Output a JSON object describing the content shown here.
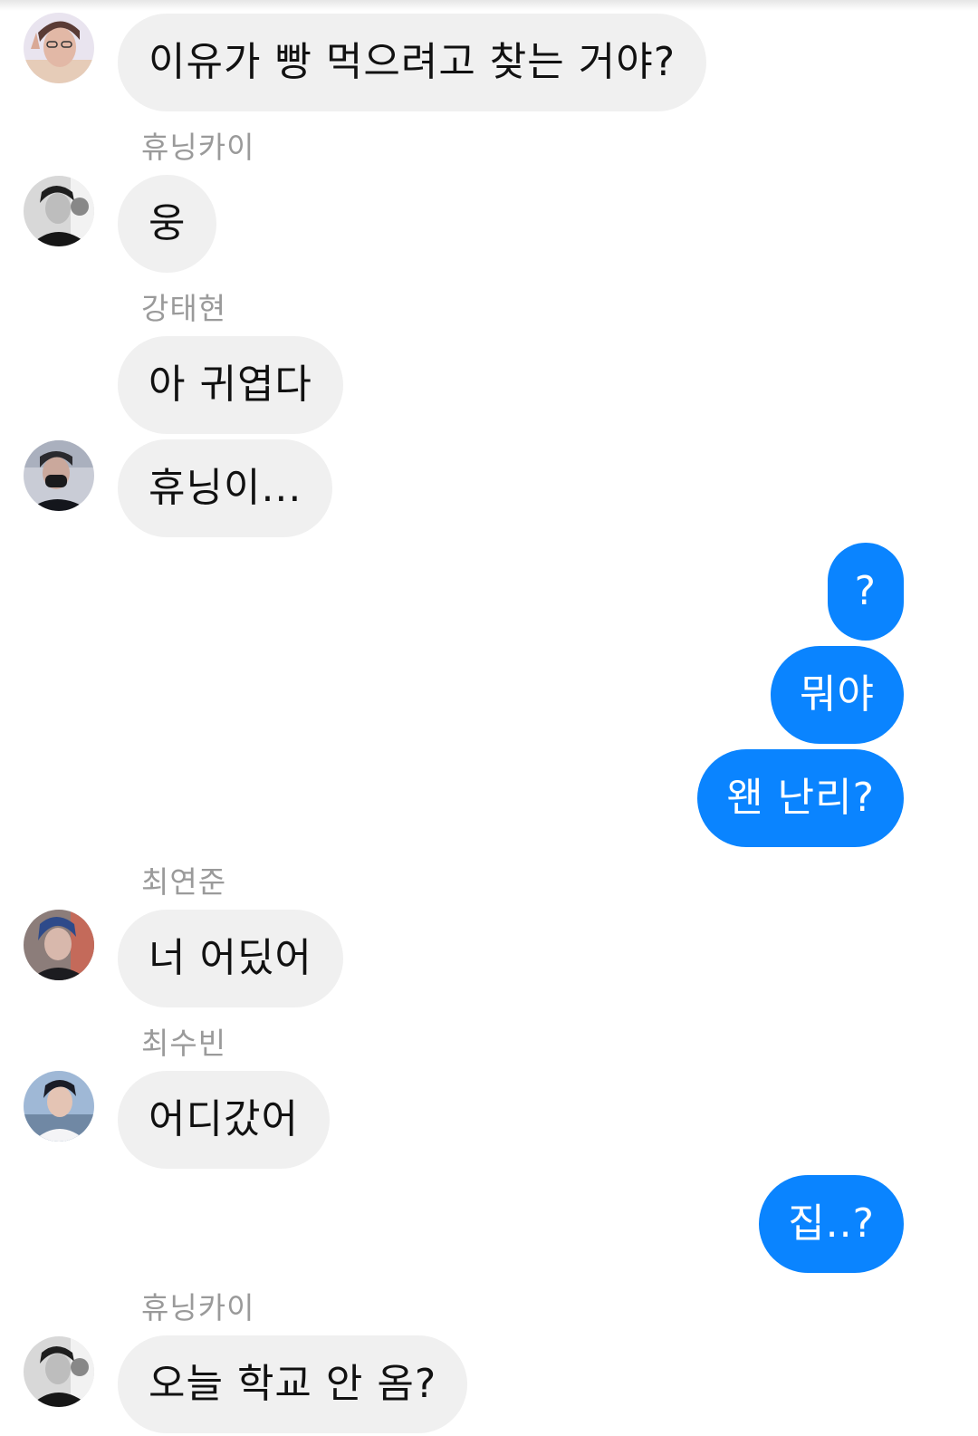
{
  "messages": [
    {
      "sender": "",
      "text": "이유가 빵 먹으려고 찾는 거야?",
      "from_me": false
    },
    {
      "sender": "휴닝카이",
      "text": "웅",
      "from_me": false
    },
    {
      "sender": "강태현",
      "text": "아 귀엽다",
      "from_me": false
    },
    {
      "sender": "",
      "text": "휴닝이...",
      "from_me": false
    },
    {
      "sender": "",
      "text": "?",
      "from_me": true
    },
    {
      "sender": "",
      "text": "뭐야",
      "from_me": true
    },
    {
      "sender": "",
      "text": "왠 난리?",
      "from_me": true
    },
    {
      "sender": "최연준",
      "text": "너 어딨어",
      "from_me": false
    },
    {
      "sender": "최수빈",
      "text": "어디갔어",
      "from_me": false
    },
    {
      "sender": "",
      "text": "집..?",
      "from_me": true
    },
    {
      "sender": "휴닝카이",
      "text": "오늘 학교 안 옴?",
      "from_me": false
    }
  ],
  "colors": {
    "incoming_bubble": "#f0f0f0",
    "outgoing_bubble": "#0a84ff",
    "sender_name": "#9a9a9a"
  }
}
